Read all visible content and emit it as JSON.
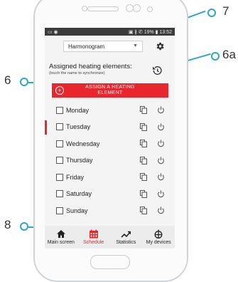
{
  "callouts": {
    "c7": "7",
    "c6a": "6a",
    "c6": "6",
    "c8": "8"
  },
  "status": {
    "left": "▭ ◉",
    "right": "▣ ∦ ✆ 19% ▮ 13:52"
  },
  "dropdown": {
    "value": "Harmonogram"
  },
  "assigned": {
    "title": "Assigned heating elements:",
    "subtitle": "(touch the name to synchronize)"
  },
  "assign_button": {
    "label": "ASSIGN A HEATING ELEMENT"
  },
  "days": [
    {
      "label": "Monday"
    },
    {
      "label": "Tuesday"
    },
    {
      "label": "Wednesday"
    },
    {
      "label": "Thursday"
    },
    {
      "label": "Friday"
    },
    {
      "label": "Saturday"
    },
    {
      "label": "Sunday"
    }
  ],
  "nav": [
    {
      "label": "Main screen",
      "icon": "home-icon"
    },
    {
      "label": "Schedule",
      "icon": "calendar-icon"
    },
    {
      "label": "Statistics",
      "icon": "trend-icon"
    },
    {
      "label": "My devices",
      "icon": "devices-icon"
    }
  ],
  "colors": {
    "accent": "#e8262d",
    "callout": "#2ea6c9"
  }
}
